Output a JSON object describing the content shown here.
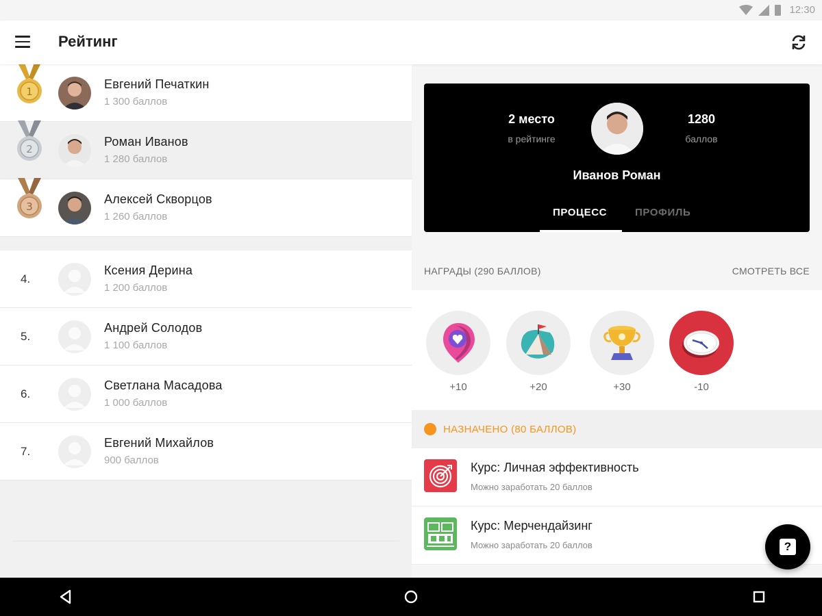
{
  "status_bar": {
    "time": "12:30",
    "icons": [
      "wifi-icon",
      "signal-icon",
      "battery-icon"
    ]
  },
  "app_bar": {
    "title": "Рейтинг",
    "menu_icon": "menu-icon",
    "refresh_icon": "refresh-icon"
  },
  "leaderboard": {
    "top": [
      {
        "rank": "1",
        "name": "Евгений Печаткин",
        "points": "1 300 баллов",
        "medal": "gold"
      },
      {
        "rank": "2",
        "name": "Роман Иванов",
        "points": "1 280 баллов",
        "medal": "silver"
      },
      {
        "rank": "3",
        "name": "Алексей Скворцов",
        "points": "1 260 баллов",
        "medal": "bronze"
      }
    ],
    "rest": [
      {
        "rank": "4.",
        "name": "Ксения Дерина",
        "points": "1 200 баллов"
      },
      {
        "rank": "5.",
        "name": "Андрей Солодов",
        "points": "1 100 баллов"
      },
      {
        "rank": "6.",
        "name": "Светлана Масадова",
        "points": "1 000 баллов"
      },
      {
        "rank": "7.",
        "name": "Евгений Михайлов",
        "points": "900 баллов"
      }
    ]
  },
  "profile": {
    "place": "2 место",
    "place_caption": "в рейтинге",
    "points": "1280",
    "points_caption": "баллов",
    "name": "Иванов Роман",
    "tabs": {
      "process": "ПРОЦЕСС",
      "profile": "ПРОФИЛЬ"
    }
  },
  "awards": {
    "title": "НАГРАДЫ (290 БАЛЛОВ)",
    "see_all": "СМОТРЕТЬ ВСЕ",
    "items": [
      {
        "icon": "heart-pin-icon",
        "value": "+10"
      },
      {
        "icon": "mountain-flag-icon",
        "value": "+20"
      },
      {
        "icon": "trophy-icon",
        "value": "+30"
      },
      {
        "icon": "clock-icon",
        "value": "-10"
      }
    ]
  },
  "assigned": {
    "label": "НАЗНАЧЕНО (80 БАЛЛОВ)",
    "accent": "#f7941d",
    "courses": [
      {
        "title": "Курс: Личная эффективность",
        "subtitle": "Можно заработать 20 баллов",
        "icon": "target-icon"
      },
      {
        "title": "Курс: Мерчендайзинг",
        "subtitle": "Можно заработать 20 баллов",
        "icon": "merchandising-icon"
      }
    ]
  },
  "fab": {
    "label": "?",
    "icon": "help-icon"
  },
  "nav_bar": {
    "icons": [
      "back-icon",
      "home-icon",
      "recents-icon"
    ]
  }
}
